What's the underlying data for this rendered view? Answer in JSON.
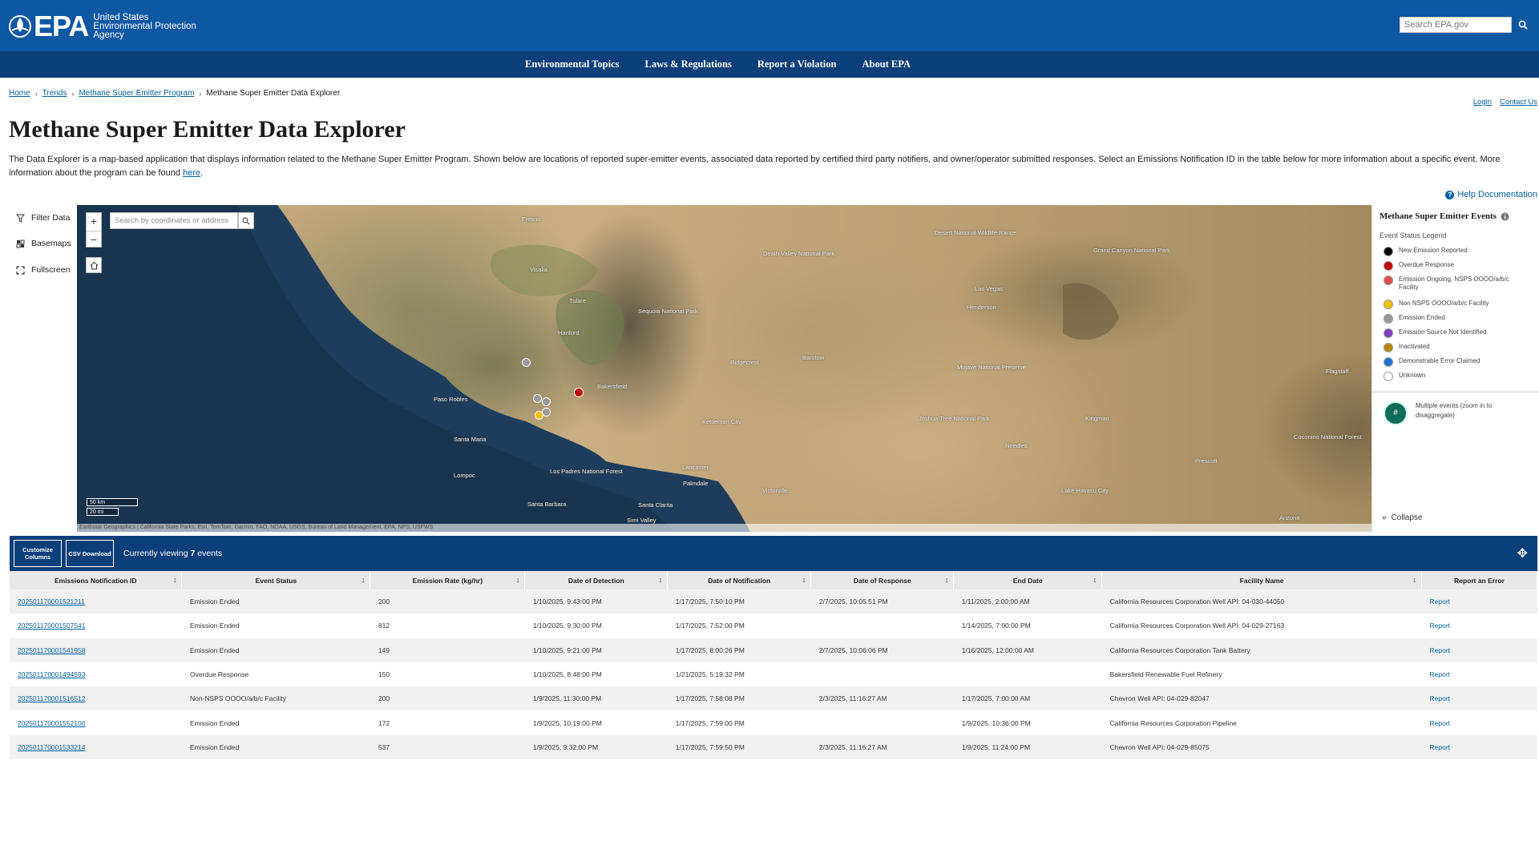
{
  "header": {
    "logo_text": "EPA",
    "agency_line1": "United States",
    "agency_line2": "Environmental Protection",
    "agency_line3": "Agency",
    "search_placeholder": "Search EPA.gov"
  },
  "nav": [
    "Environmental Topics",
    "Laws & Regulations",
    "Report a Violation",
    "About EPA"
  ],
  "breadcrumb": [
    "Home",
    "Trends",
    "Methane Super Emitter Program",
    "Methane Super Emitter Data Explorer"
  ],
  "utility_links": [
    "Login",
    "Contact Us"
  ],
  "page_title": "Methane Super Emitter Data Explorer",
  "intro_text": "The Data Explorer is a map-based application that displays information related to the Methane Super Emitter Program. Shown below are locations of reported super-emitter events, associated data reported by certified third party notifiers, and owner/operator submitted responses. Select an Emissions Notification ID in the table below for more information about a specific event. More information about the program can be found ",
  "intro_link": "here",
  "help_doc": "Help Documentation",
  "tools": [
    "Filter Data",
    "Basemaps",
    "Fullscreen"
  ],
  "map": {
    "search_placeholder": "Search by coordinates or address",
    "scale": [
      "50 km",
      "20 mi"
    ],
    "attribution": "Earthstar Geographics | California State Parks, Esri, TomTom, Garmin, FAO, NOAA, USGS, Bureau of Land Management, EPA, NPS, USFWS",
    "labels": [
      "Fresno",
      "Visalia",
      "Tulare",
      "Bakersfield",
      "Paso Robles",
      "Santa Maria",
      "Lompoc",
      "Santa Barbara",
      "Santa Clarita",
      "Lancaster",
      "Palmdale",
      "Victorville",
      "Barstow",
      "Las Vegas",
      "Henderson",
      "Ridgecrest",
      "Mojave National Preserve",
      "Death Valley National Park",
      "Joshua Tree National Park",
      "Lake Havasu City",
      "Kingman",
      "Flagstaff",
      "Prescott",
      "Grand Canyon National Park",
      "Arizona",
      "Needles",
      "Kettleman City",
      "Hanford",
      "Sequoia National Park",
      "Simi Valley",
      "Los Padres National Forest",
      "Desert National Wildlife Range",
      "Coconino National Forest"
    ]
  },
  "legend": {
    "title": "Methane Super Emitter Events",
    "subtitle": "Event Status Legend",
    "items": [
      {
        "label": "New Emission Reported",
        "color": "#000000"
      },
      {
        "label": "Overdue Response",
        "color": "#c00000"
      },
      {
        "label": "Emission Ongoing, NSPS OOOO/a/b/c Facility",
        "color": "#e05050"
      },
      {
        "label": "Non NSPS OOOO/a/b/c Facility",
        "color": "#f2c200"
      },
      {
        "label": "Emission Ended",
        "color": "#9a9a9a"
      },
      {
        "label": "Emission Source Not Identified",
        "color": "#7b3fbf"
      },
      {
        "label": "Inactivated",
        "color": "#b8860b"
      },
      {
        "label": "Demonstrable Error Claimed",
        "color": "#1f6fd1"
      },
      {
        "label": "Unknown",
        "color": "#ffffff"
      }
    ],
    "multi_symbol": "#",
    "multi_label": "Multiple events (zoom in to disaggregate)",
    "collapse": "Collapse"
  },
  "table_bar": {
    "customize": "Customize Columns",
    "csv": "CSV Download",
    "viewing_prefix": "Currently viewing ",
    "viewing_count": "7",
    "viewing_suffix": " events"
  },
  "table": {
    "columns": [
      "Emissions Notification ID",
      "Event Status",
      "Emission Rate (kg/hr)",
      "Date of Detection",
      "Date of Notification",
      "Date of Response",
      "End Date",
      "Facility Name",
      "Report an Error"
    ],
    "rows": [
      [
        "202501170001521211",
        "Emission Ended",
        "200",
        "1/10/2025, 9:43:00 PM",
        "1/17/2025, 7:50:10 PM",
        "2/7/2025, 10:05:51 PM",
        "1/11/2025, 2:00:00 AM",
        "California Resources Corporation Well API: 04-030-44050",
        "Report"
      ],
      [
        "202501170001507541",
        "Emission Ended",
        "812",
        "1/10/2025, 9:30:00 PM",
        "1/17/2025, 7:52:00 PM",
        "",
        "1/14/2025, 7:00:00 PM",
        "California Resources Corporation Well API: 04-029-27163",
        "Report"
      ],
      [
        "202501170001541958",
        "Emission Ended",
        "149",
        "1/10/2025, 9:21:00 PM",
        "1/17/2025, 8:00:26 PM",
        "2/7/2025, 10:06:06 PM",
        "1/16/2025, 12:00:00 AM",
        "California Resources Corporation Tank Battery",
        "Report"
      ],
      [
        "202501170001494593",
        "Overdue Response",
        "150",
        "1/10/2025, 8:48:00 PM",
        "1/21/2025, 5:19:32 PM",
        "",
        "",
        "Bakersfield Renewable Fuel Refinery",
        "Report"
      ],
      [
        "202501170001516512",
        "Non-NSPS OOOO/a/b/c Facility",
        "200",
        "1/9/2025, 11:30:00 PM",
        "1/17/2025, 7:58:08 PM",
        "2/3/2025, 11:16:27 AM",
        "1/17/2025, 7:00:00 AM",
        "Chevron Well API: 04-029-82047",
        "Report"
      ],
      [
        "202501170001552100",
        "Emission Ended",
        "172",
        "1/9/2025, 10:19:00 PM",
        "1/17/2025, 7:59:00 PM",
        "",
        "1/9/2025, 10:36:00 PM",
        "California Resources Corporation Pipeline",
        "Report"
      ],
      [
        "202501170001533214",
        "Emission Ended",
        "537",
        "1/9/2025, 9:32:00 PM",
        "1/17/2025, 7:59:50 PM",
        "2/3/2025, 11:16:27 AM",
        "1/9/2025, 11:24:00 PM",
        "Chevron Well API: 04-029-85075",
        "Report"
      ]
    ]
  },
  "colors": {
    "header_blue": "#0e57a3",
    "nav_blue": "#0b3f7a",
    "link_blue": "#005ea2"
  }
}
